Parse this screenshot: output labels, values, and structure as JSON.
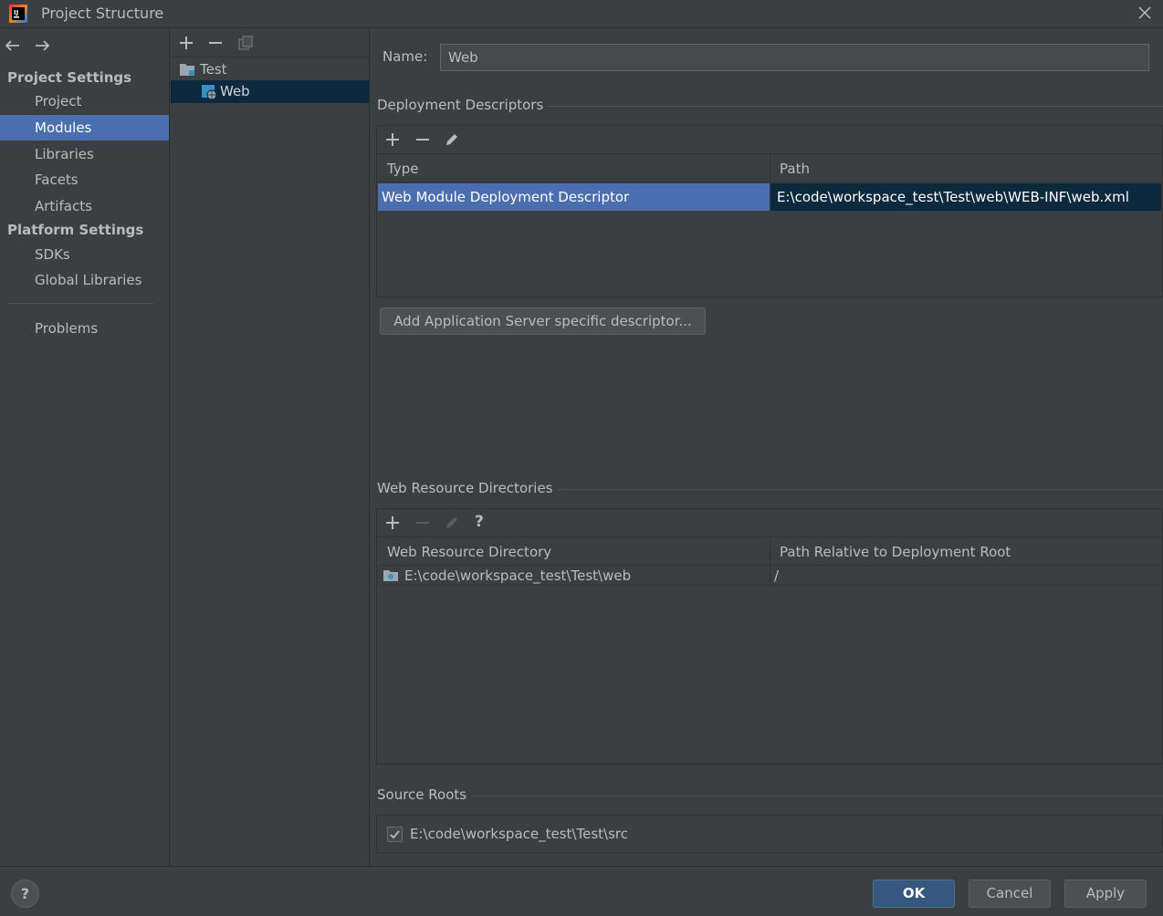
{
  "window": {
    "title": "Project Structure"
  },
  "sidebar": {
    "project_settings_title": "Project Settings",
    "project_items": [
      "Project",
      "Modules",
      "Libraries",
      "Facets",
      "Artifacts"
    ],
    "platform_settings_title": "Platform Settings",
    "platform_items": [
      "SDKs",
      "Global Libraries"
    ],
    "problems_label": "Problems",
    "selected": "Modules"
  },
  "tree": {
    "root_label": "Test",
    "child_label": "Web"
  },
  "module": {
    "name_label": "Name:",
    "name_value": "Web"
  },
  "deployment_descriptors": {
    "title": "Deployment Descriptors",
    "columns": [
      "Type",
      "Path"
    ],
    "rows": [
      {
        "type": "Web Module Deployment Descriptor",
        "path": "E:\\code\\workspace_test\\Test\\web\\WEB-INF\\web.xml"
      }
    ],
    "add_server_button": "Add Application Server specific descriptor..."
  },
  "web_resource_directories": {
    "title": "Web Resource Directories",
    "help_label": "?",
    "columns": [
      "Web Resource Directory",
      "Path Relative to Deployment Root"
    ],
    "rows": [
      {
        "directory": "E:\\code\\workspace_test\\Test\\web",
        "relative": "/"
      }
    ]
  },
  "source_roots": {
    "title": "Source Roots",
    "items": [
      {
        "path": "E:\\code\\workspace_test\\Test\\src",
        "checked": true
      }
    ]
  },
  "footer": {
    "help_label": "?",
    "ok_label": "OK",
    "cancel_label": "Cancel",
    "apply_label": "Apply"
  },
  "colors": {
    "background": "#3c3f41",
    "selection": "#4b6eaf",
    "tree_selection": "#0d293e",
    "ok_button": "#365880"
  }
}
